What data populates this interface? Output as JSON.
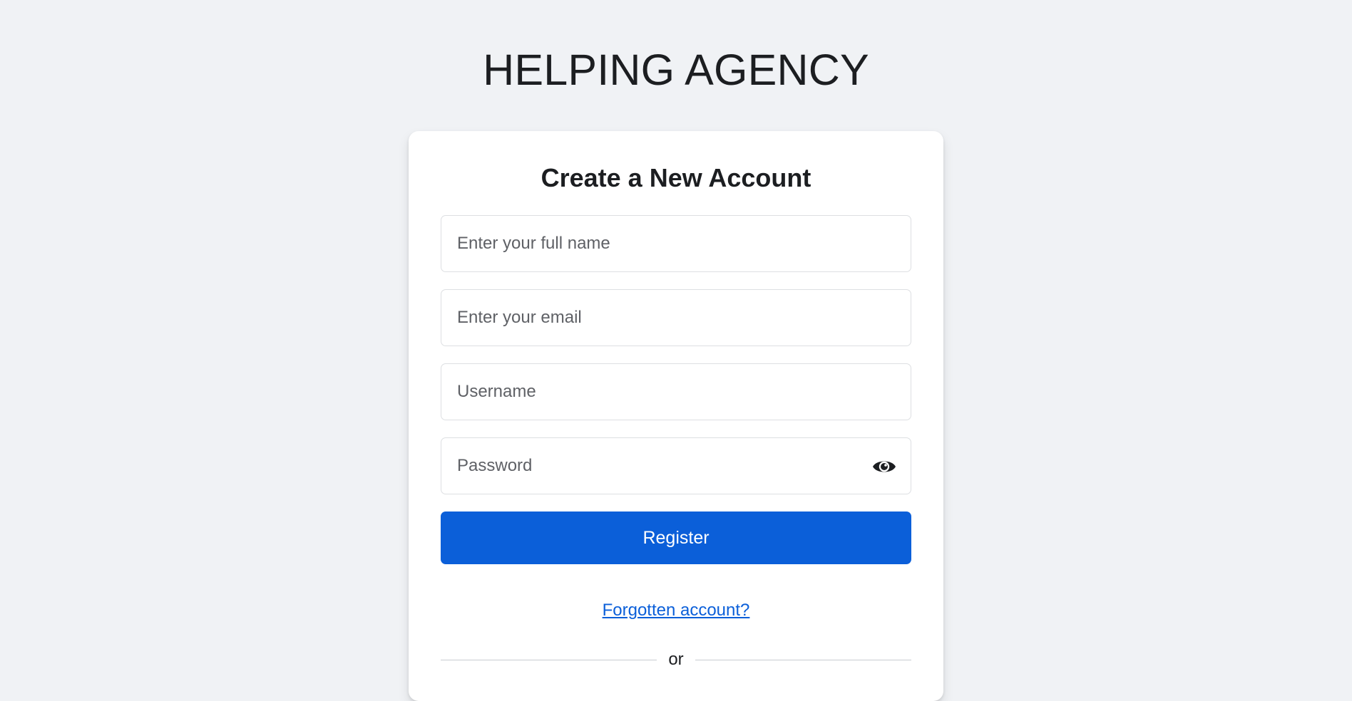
{
  "brand": {
    "title": "HELPING AGENCY"
  },
  "form": {
    "title": "Create a New Account",
    "full_name": {
      "placeholder": "Enter your full name",
      "value": ""
    },
    "email": {
      "placeholder": "Enter your email",
      "value": ""
    },
    "username": {
      "placeholder": "Username",
      "value": ""
    },
    "password": {
      "placeholder": "Password",
      "value": "",
      "toggle_icon": "eye-icon"
    },
    "register_label": "Register",
    "forgot_label": "Forgotten account?",
    "divider_label": "or"
  },
  "colors": {
    "background": "#f0f2f5",
    "card": "#ffffff",
    "primary": "#0b5fd9",
    "text": "#1c1e21",
    "border": "#dddfe2"
  }
}
